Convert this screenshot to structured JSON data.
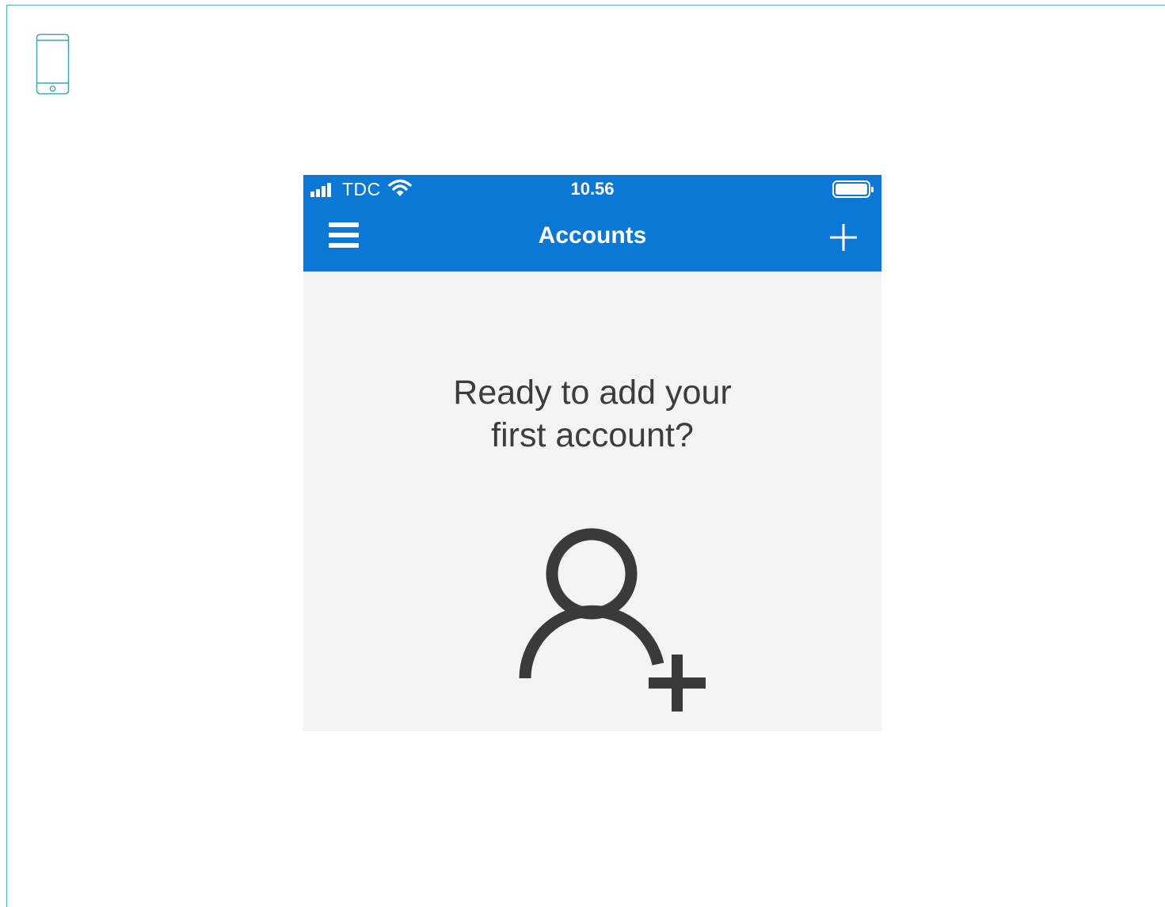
{
  "device_icon": "smartphone-icon",
  "status_bar": {
    "carrier": "TDC",
    "time": "10.56",
    "signal_icon": "signal-bars-icon",
    "wifi_icon": "wifi-icon",
    "battery_icon": "battery-icon"
  },
  "nav_bar": {
    "title": "Accounts",
    "menu_icon": "hamburger-menu-icon",
    "add_icon": "plus-icon"
  },
  "empty_state": {
    "line1": "Ready to add your",
    "line2": "first account?",
    "illustration_icon": "add-user-icon"
  },
  "colors": {
    "accent": "#0b78d6",
    "background": "#f3f3f3",
    "text": "#3c3c3c",
    "frame_border": "#4bb5c8"
  }
}
